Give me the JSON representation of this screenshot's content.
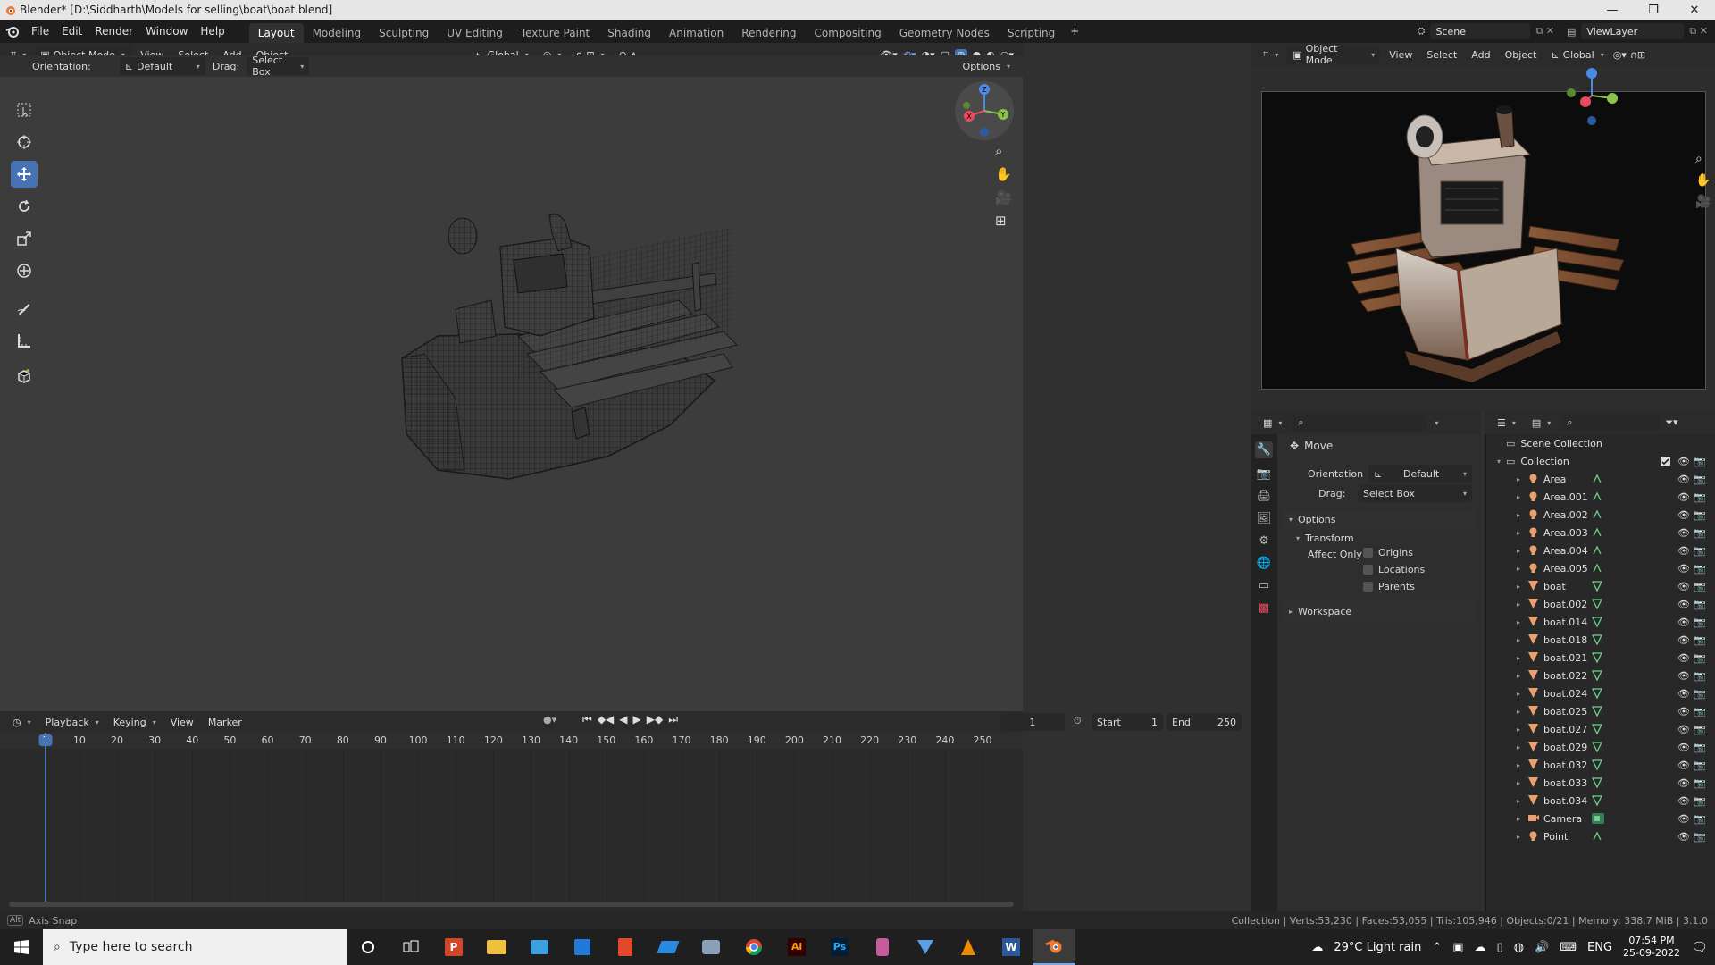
{
  "window": {
    "title": "Blender* [D:\\Siddharth\\Models for selling\\boat\\boat.blend]",
    "minimize": "—",
    "restore": "❐",
    "close": "✕"
  },
  "menus": [
    "File",
    "Edit",
    "Render",
    "Window",
    "Help"
  ],
  "workspaces": [
    "Layout",
    "Modeling",
    "Sculpting",
    "UV Editing",
    "Texture Paint",
    "Shading",
    "Animation",
    "Rendering",
    "Compositing",
    "Geometry Nodes",
    "Scripting"
  ],
  "workspace_add": "+",
  "scene": {
    "label": "Scene",
    "view_layer": "ViewLayer"
  },
  "viewport": {
    "mode": "Object Mode",
    "menus": [
      "View",
      "Select",
      "Add",
      "Object"
    ],
    "transform_orientation": "Global",
    "tool_orientation_label": "Orientation:",
    "tool_orientation": "Default",
    "drag_label": "Drag:",
    "drag": "Select Box",
    "options": "Options"
  },
  "gizmo_axes": {
    "x": "X",
    "y": "Y",
    "z": "Z"
  },
  "camera_view": {
    "mode": "Object Mode",
    "menus": [
      "View",
      "Select",
      "Add",
      "Object"
    ],
    "transform_orientation": "Global"
  },
  "tools": [
    "select-box-icon",
    "cursor-icon",
    "move-icon",
    "rotate-icon",
    "scale-icon",
    "transform-icon",
    "annotate-icon",
    "measure-icon",
    "add-cube-icon"
  ],
  "properties": {
    "tool_name": "Move",
    "orientation_label": "Orientation",
    "orientation_value": "Default",
    "drag_label": "Drag:",
    "drag_value": "Select Box",
    "options_section": "Options",
    "transform_section": "Transform",
    "affect_only_label": "Affect Only",
    "affect_options": [
      "Origins",
      "Locations",
      "Parents"
    ],
    "workspace_section": "Workspace"
  },
  "outliner": {
    "scene_collection": "Scene Collection",
    "collection": "Collection",
    "items": [
      {
        "name": "Area",
        "type": "light"
      },
      {
        "name": "Area.001",
        "type": "light"
      },
      {
        "name": "Area.002",
        "type": "light"
      },
      {
        "name": "Area.003",
        "type": "light"
      },
      {
        "name": "Area.004",
        "type": "light"
      },
      {
        "name": "Area.005",
        "type": "light"
      },
      {
        "name": "boat",
        "type": "mesh"
      },
      {
        "name": "boat.002",
        "type": "mesh"
      },
      {
        "name": "boat.014",
        "type": "mesh"
      },
      {
        "name": "boat.018",
        "type": "mesh"
      },
      {
        "name": "boat.021",
        "type": "mesh"
      },
      {
        "name": "boat.022",
        "type": "mesh"
      },
      {
        "name": "boat.024",
        "type": "mesh"
      },
      {
        "name": "boat.025",
        "type": "mesh"
      },
      {
        "name": "boat.027",
        "type": "mesh"
      },
      {
        "name": "boat.029",
        "type": "mesh"
      },
      {
        "name": "boat.032",
        "type": "mesh"
      },
      {
        "name": "boat.033",
        "type": "mesh"
      },
      {
        "name": "boat.034",
        "type": "mesh"
      },
      {
        "name": "Camera",
        "type": "camera"
      },
      {
        "name": "Point",
        "type": "light"
      }
    ]
  },
  "timeline": {
    "menus": [
      "Playback",
      "Keying",
      "View",
      "Marker"
    ],
    "current_frame": "1",
    "start_label": "Start",
    "start": "1",
    "end_label": "End",
    "end": "250",
    "ruler": [
      "1",
      "10",
      "20",
      "30",
      "40",
      "50",
      "60",
      "70",
      "80",
      "90",
      "100",
      "110",
      "120",
      "130",
      "140",
      "150",
      "160",
      "170",
      "180",
      "190",
      "200",
      "210",
      "220",
      "230",
      "240",
      "250"
    ]
  },
  "status": {
    "left": "Axis Snap",
    "right": "Collection | Verts:53,230 | Faces:53,055 | Tris:105,946 | Objects:0/21 | Memory: 338.7 MiB | 3.1.0"
  },
  "taskbar": {
    "search_placeholder": "Type here to search",
    "weather": "29°C  Light rain",
    "lang": "ENG",
    "time": "07:54 PM",
    "date": "25-09-2022"
  },
  "colors": {
    "accent": "#4772b3",
    "x_axis": "#e84a5f",
    "y_axis": "#8cc34a",
    "z_axis": "#4a8be8",
    "mesh_green": "#6fd08c"
  }
}
